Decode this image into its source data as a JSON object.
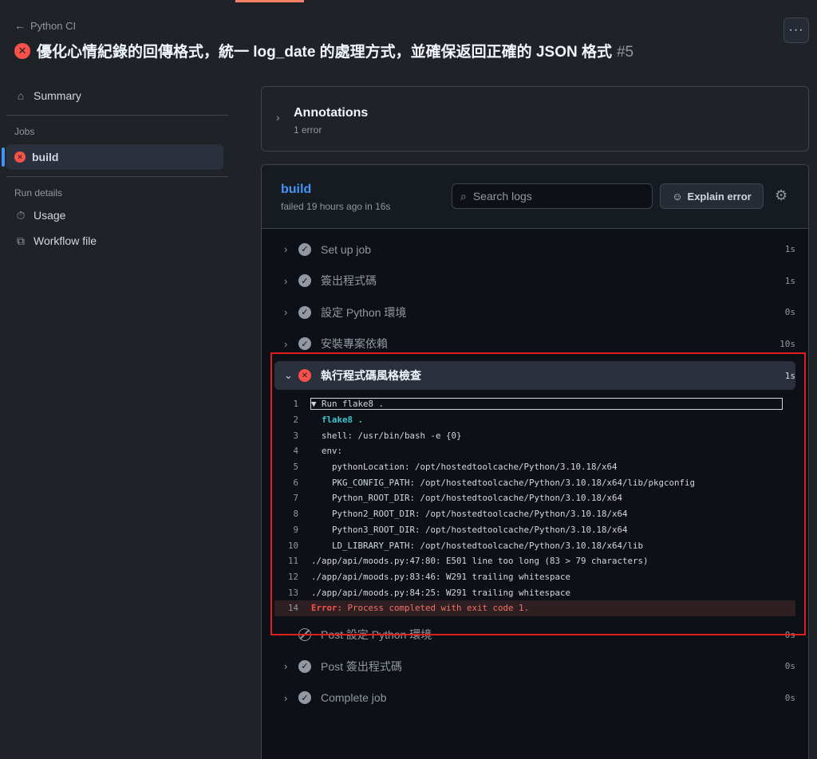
{
  "header": {
    "back_label": "Python CI",
    "title": "優化心情紀錄的回傳格式，統一 log_date 的處理方式，並確保返回正確的 JSON 格式",
    "run_number": "#5",
    "more_label": "···"
  },
  "sidebar": {
    "summary_label": "Summary",
    "jobs_heading": "Jobs",
    "job_label": "build",
    "run_details_heading": "Run details",
    "usage_label": "Usage",
    "workflow_label": "Workflow file"
  },
  "annotations": {
    "title": "Annotations",
    "subtitle": "1 error"
  },
  "job": {
    "name": "build",
    "status": "failed 19 hours ago in 16s",
    "search_placeholder": "Search logs",
    "explain_label": "Explain error"
  },
  "steps_before": [
    {
      "label": "Set up job",
      "time": "1s",
      "status": "success"
    },
    {
      "label": "簽出程式碼",
      "time": "1s",
      "status": "success"
    },
    {
      "label": "設定 Python 環境",
      "time": "0s",
      "status": "success"
    },
    {
      "label": "安裝專案依賴",
      "time": "10s",
      "status": "success"
    }
  ],
  "expanded_step": {
    "label": "執行程式碼風格檢查",
    "time": "1s",
    "status": "failure"
  },
  "log": [
    {
      "n": "1",
      "text": "▼ Run flake8 ."
    },
    {
      "n": "2",
      "text": "  flake8 ."
    },
    {
      "n": "3",
      "text": "  shell: /usr/bin/bash -e {0}"
    },
    {
      "n": "4",
      "text": "  env:"
    },
    {
      "n": "5",
      "text": "    pythonLocation: /opt/hostedtoolcache/Python/3.10.18/x64"
    },
    {
      "n": "6",
      "text": "    PKG_CONFIG_PATH: /opt/hostedtoolcache/Python/3.10.18/x64/lib/pkgconfig"
    },
    {
      "n": "7",
      "text": "    Python_ROOT_DIR: /opt/hostedtoolcache/Python/3.10.18/x64"
    },
    {
      "n": "8",
      "text": "    Python2_ROOT_DIR: /opt/hostedtoolcache/Python/3.10.18/x64"
    },
    {
      "n": "9",
      "text": "    Python3_ROOT_DIR: /opt/hostedtoolcache/Python/3.10.18/x64"
    },
    {
      "n": "10",
      "text": "    LD_LIBRARY_PATH: /opt/hostedtoolcache/Python/3.10.18/x64/lib"
    },
    {
      "n": "11",
      "text": "./app/api/moods.py:47:80: E501 line too long (83 > 79 characters)"
    },
    {
      "n": "12",
      "text": "./app/api/moods.py:83:46: W291 trailing whitespace"
    },
    {
      "n": "13",
      "text": "./app/api/moods.py:84:25: W291 trailing whitespace"
    },
    {
      "n": "14",
      "keyword": "Error:",
      "text": " Process completed with exit code 1."
    }
  ],
  "steps_after": [
    {
      "label": "Post 設定 Python 環境",
      "time": "0s",
      "status": "skipped"
    },
    {
      "label": "Post 簽出程式碼",
      "time": "0s",
      "status": "success"
    },
    {
      "label": "Complete job",
      "time": "0s",
      "status": "success"
    }
  ],
  "colors": {
    "accent": "#4493f8",
    "failure": "#f85149",
    "highlight_box": "#e01e1e"
  }
}
